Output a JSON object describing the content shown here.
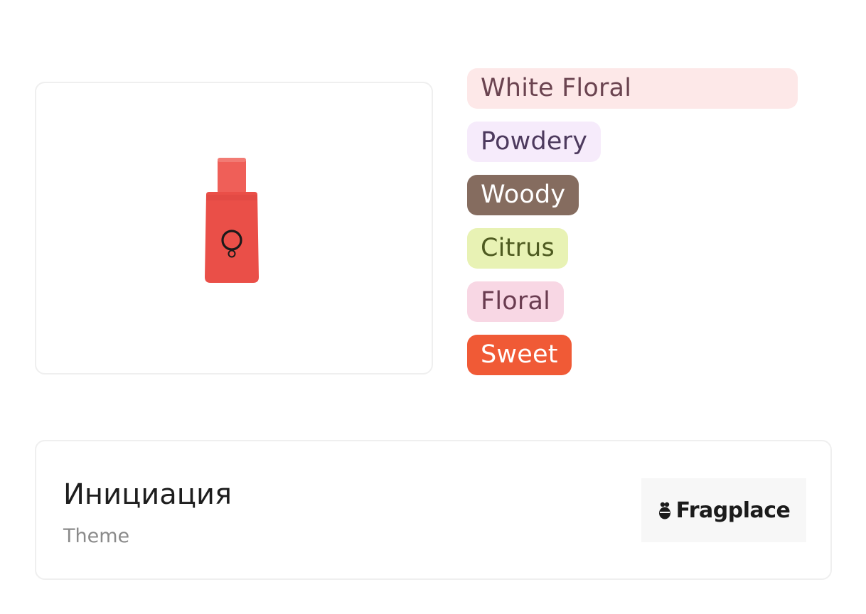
{
  "accords": [
    {
      "label": "White Floral",
      "bg": "#fde8e8",
      "color": "#6b4450",
      "wide": true
    },
    {
      "label": "Powdery",
      "bg": "#f6ebfb",
      "color": "#4d3a5e"
    },
    {
      "label": "Woody",
      "bg": "#856c5f",
      "color": "#ffffff"
    },
    {
      "label": "Citrus",
      "bg": "#e8f2b4",
      "color": "#4e5a20"
    },
    {
      "label": "Floral",
      "bg": "#f8d7e4",
      "color": "#6a3c50"
    },
    {
      "label": "Sweet",
      "bg": "#f05a36",
      "color": "#ffffff"
    }
  ],
  "perfume": {
    "title": "Инициация",
    "subtitle": "Theme"
  },
  "brand": {
    "name": "Fragplace",
    "icon": "bee-icon"
  },
  "colors": {
    "bottle": "#ea4f48",
    "bottle_cap": "#ef5f58",
    "logo_ring": "#1a1a1a"
  }
}
